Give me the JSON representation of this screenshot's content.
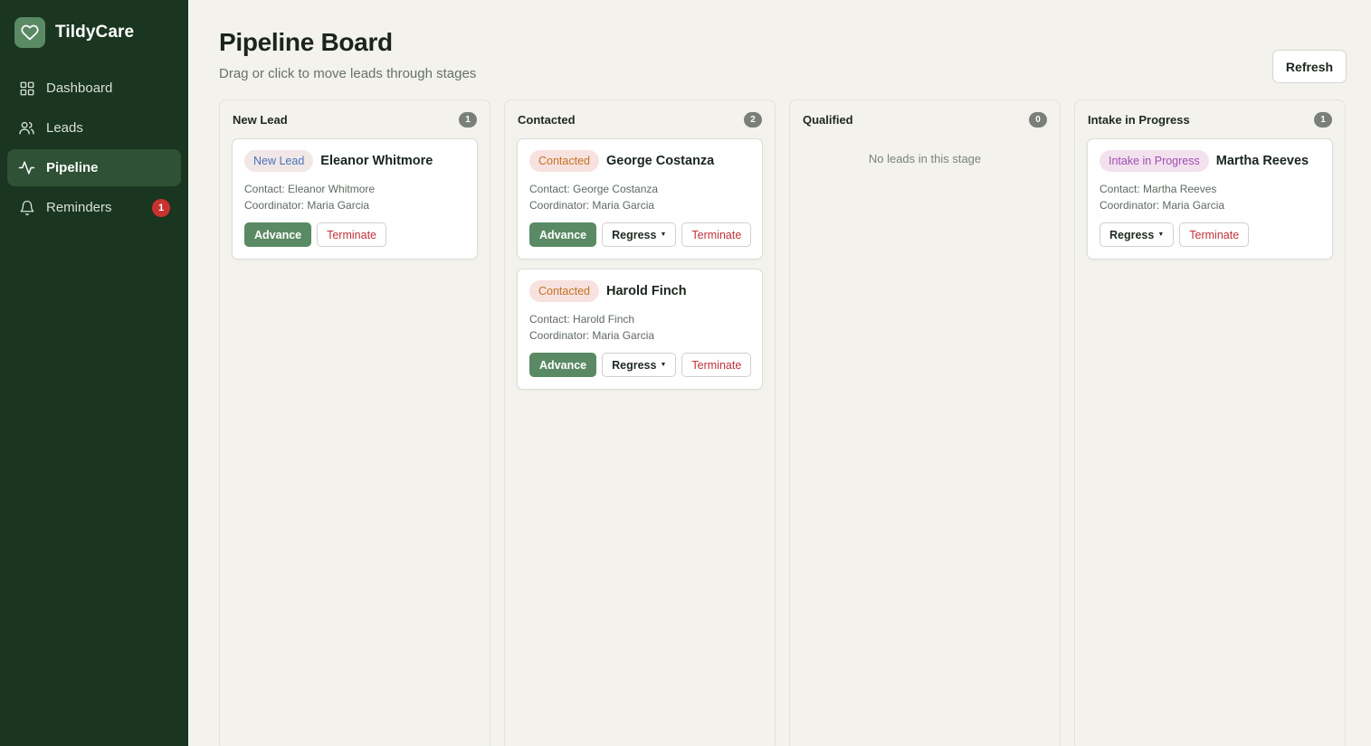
{
  "app": {
    "name": "TildyCare",
    "logo_icon": "heart-icon"
  },
  "sidebar": {
    "items": [
      {
        "label": "Dashboard",
        "icon": "grid-icon",
        "active": false,
        "badge": null
      },
      {
        "label": "Leads",
        "icon": "users-icon",
        "active": false,
        "badge": null
      },
      {
        "label": "Pipeline",
        "icon": "pulse-icon",
        "active": true,
        "badge": null
      },
      {
        "label": "Reminders",
        "icon": "bell-icon",
        "active": false,
        "badge": "1"
      }
    ]
  },
  "header": {
    "title": "Pipeline Board",
    "subtitle": "Drag or click to move leads through stages",
    "refresh_label": "Refresh"
  },
  "columns": [
    {
      "title": "New Lead",
      "count": "1",
      "empty_text": "",
      "cards": [
        {
          "stage": "New Lead",
          "stage_class": "new",
          "name": "Eleanor Whitmore",
          "contact": "Contact: Eleanor Whitmore",
          "coordinator": "Coordinator: Maria Garcia",
          "advance": "Advance",
          "regress": null,
          "terminate": "Terminate"
        }
      ]
    },
    {
      "title": "Contacted",
      "count": "2",
      "empty_text": "",
      "cards": [
        {
          "stage": "Contacted",
          "stage_class": "contacted",
          "name": "George Costanza",
          "contact": "Contact: George Costanza",
          "coordinator": "Coordinator: Maria Garcia",
          "advance": "Advance",
          "regress": "Regress",
          "terminate": "Terminate"
        },
        {
          "stage": "Contacted",
          "stage_class": "contacted",
          "name": "Harold Finch",
          "contact": "Contact: Harold Finch",
          "coordinator": "Coordinator: Maria Garcia",
          "advance": "Advance",
          "regress": "Regress",
          "terminate": "Terminate"
        }
      ]
    },
    {
      "title": "Qualified",
      "count": "0",
      "empty_text": "No leads in this stage",
      "cards": []
    },
    {
      "title": "Intake in Progress",
      "count": "1",
      "empty_text": "",
      "cards": [
        {
          "stage": "Intake in Progress",
          "stage_class": "intake",
          "name": "Martha Reeves",
          "contact": "Contact: Martha Reeves",
          "coordinator": "Coordinator: Maria Garcia",
          "advance": null,
          "regress": "Regress",
          "terminate": "Terminate"
        }
      ]
    }
  ],
  "colors": {
    "sidebar_bg": "#1a3520",
    "sidebar_active": "#2f5135",
    "accent": "#5a8a64",
    "danger": "#c0323a",
    "badge": "#c8322f"
  }
}
